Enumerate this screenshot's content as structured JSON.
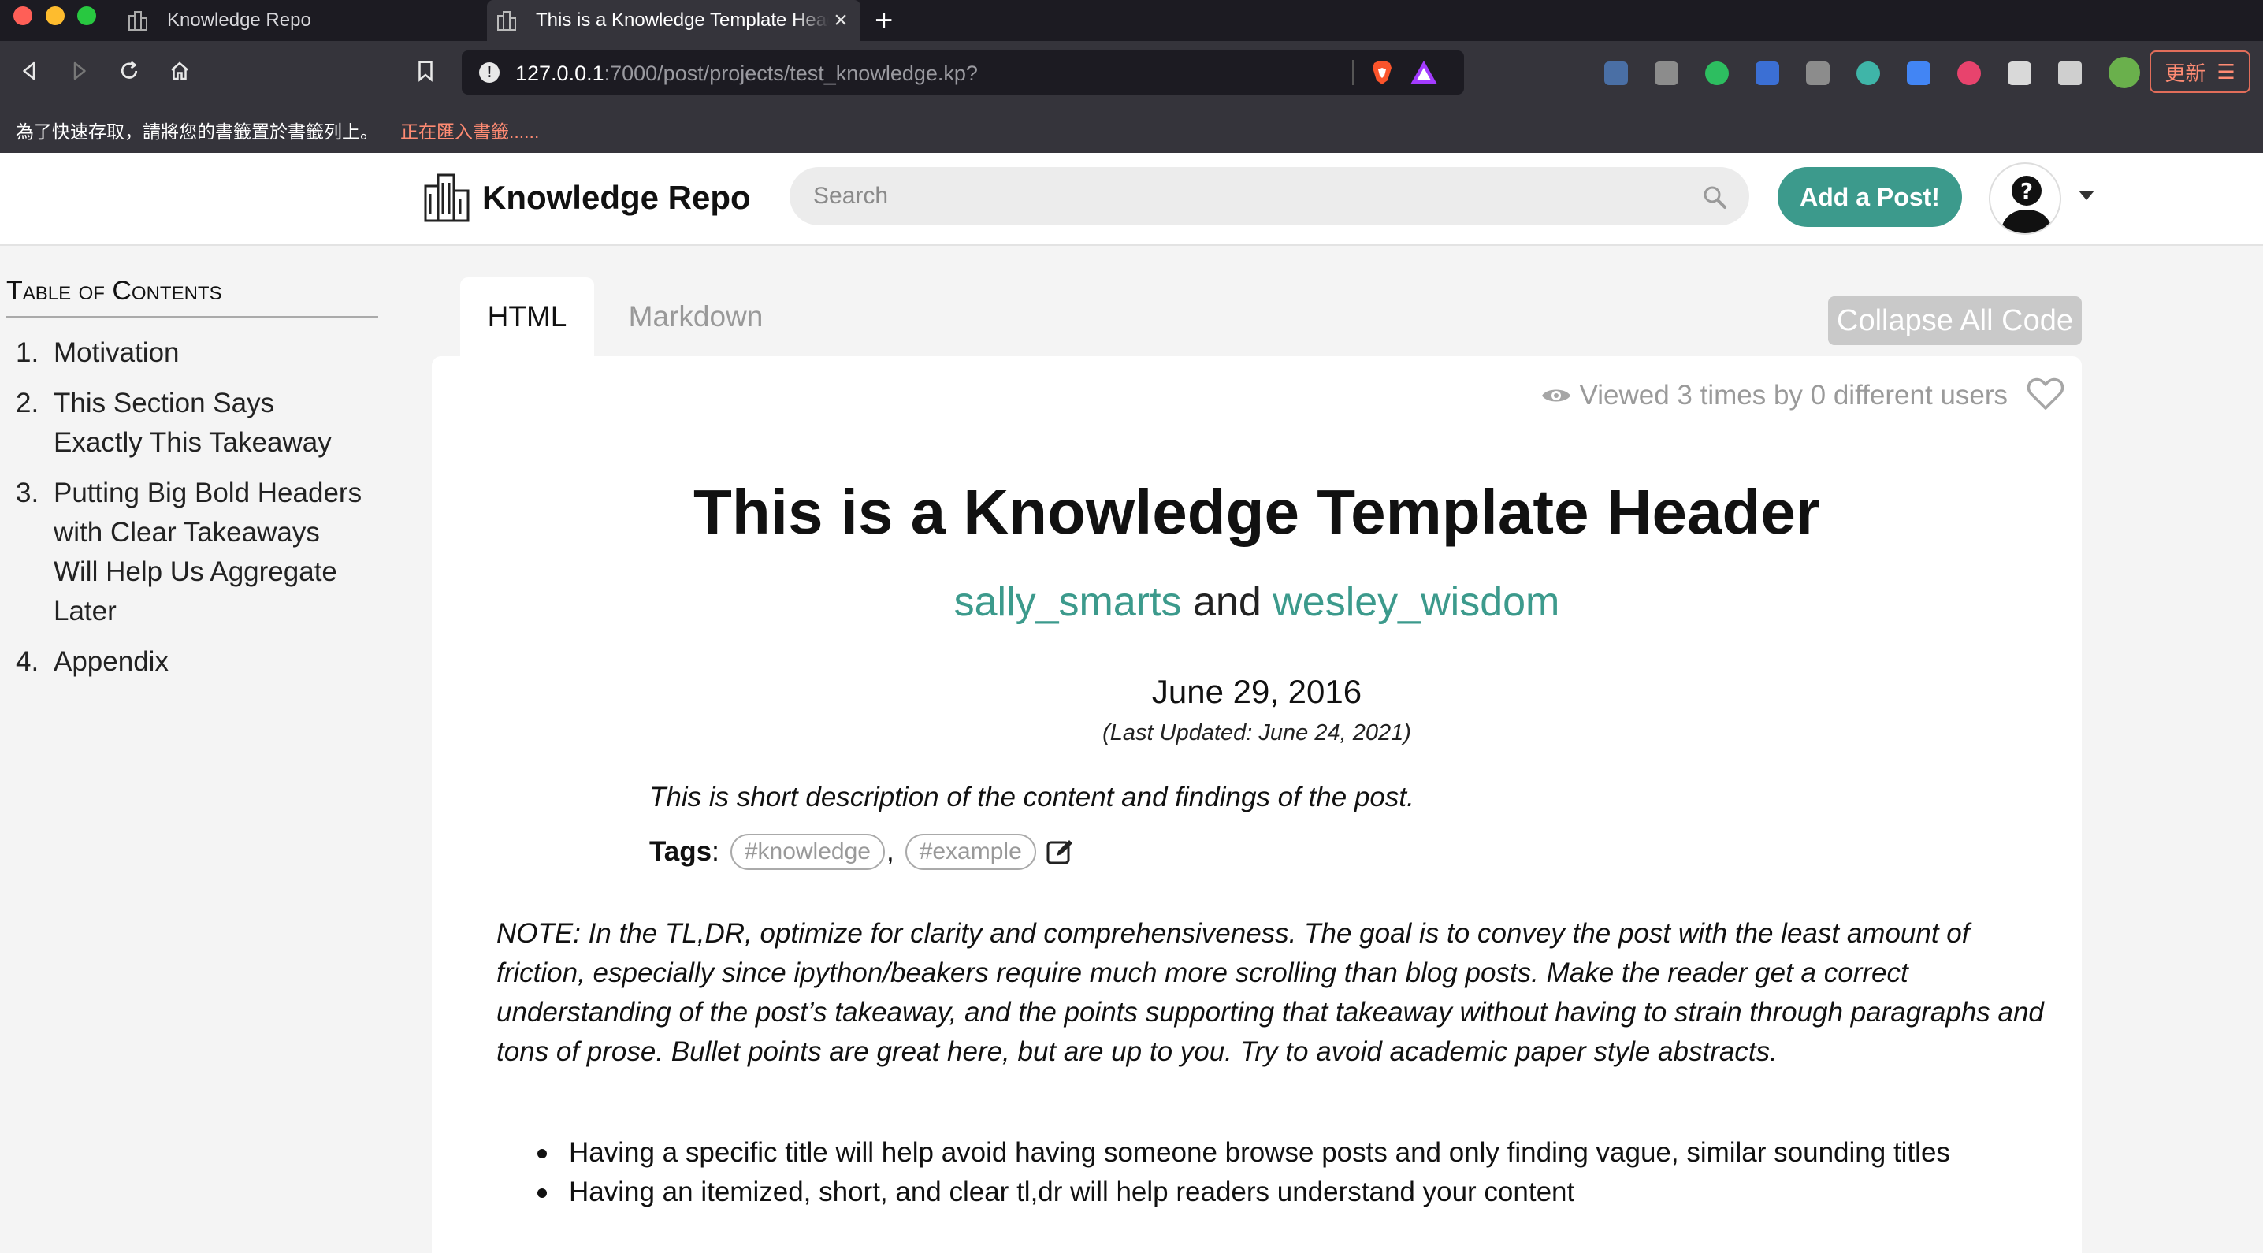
{
  "browser": {
    "tabs": [
      {
        "title": "Knowledge Repo"
      },
      {
        "title": "This is a Knowledge Template Header"
      }
    ],
    "url_host": "127.0.0.1",
    "url_rest": ":7000/post/projects/test_knowledge.kp?",
    "update_label": "更新",
    "bookmark_message": "為了快速存取，請將您的書籤置於書籤列上。",
    "bookmark_importing": "正在匯入書籤......"
  },
  "header": {
    "brand": "Knowledge Repo",
    "search_placeholder": "Search",
    "add_post_label": "Add a Post!",
    "accent_color": "#3c9a8c"
  },
  "toc": {
    "title": "Table of Contents",
    "items": [
      {
        "num": "1.",
        "label": "Motivation"
      },
      {
        "num": "2.",
        "label": "This Section Says Exactly This Takeaway"
      },
      {
        "num": "3.",
        "label": "Putting Big Bold Headers with Clear Takeaways Will Help Us Aggregate Later"
      },
      {
        "num": "4.",
        "label": "Appendix"
      }
    ]
  },
  "content_tabs": {
    "html": "HTML",
    "markdown": "Markdown",
    "collapse_label": "Collapse All Code"
  },
  "post": {
    "views_text": "Viewed 3 times by 0 different users",
    "title": "This is a Knowledge Template Header",
    "author1": "sally_smarts",
    "and": "and",
    "author2": "wesley_wisdom",
    "date": "June 29, 2016",
    "updated": "(Last Updated: June 24, 2021)",
    "tldr": "This is short description of the content and findings of the post.",
    "tags_label": "Tags",
    "tags": [
      "#knowledge",
      "#example"
    ],
    "note": "NOTE: In the TL,DR, optimize for clarity and comprehensiveness. The goal is to convey the post with the least amount of friction, especially since ipython/beakers require much more scrolling than blog posts. Make the reader get a correct understanding of the post’s takeaway, and the points supporting that takeaway without having to strain through paragraphs and tons of prose. Bullet points are great here, but are up to you. Try to avoid academic paper style abstracts.",
    "bullets": [
      "Having a specific title will help avoid having someone browse posts and only finding vague, similar sounding titles",
      "Having an itemized, short, and clear tl,dr will help readers understand your content"
    ]
  }
}
